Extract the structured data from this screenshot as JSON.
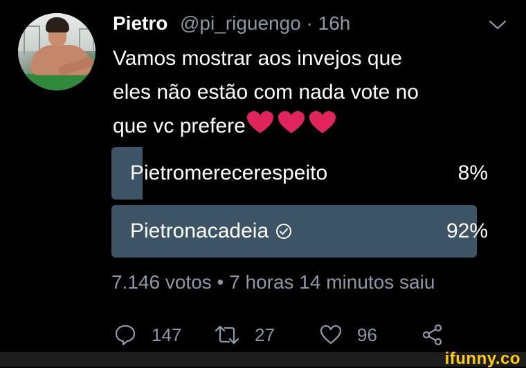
{
  "tweet": {
    "author_name": "Pietro",
    "handle_time": "@pi_riguengo · 16h",
    "text_lines": [
      "Vamos mostrar aos invejos que",
      "eles não estão com nada vote no",
      "que vc prefere"
    ],
    "emoji": "red-heart x3"
  },
  "poll": {
    "options": [
      {
        "label": "Pietromerecerespeito",
        "percent_text": "8%",
        "percent": 8,
        "selected": false
      },
      {
        "label": "Pietronacadeia",
        "percent_text": "92%",
        "percent": 92,
        "selected": true
      }
    ],
    "summary": "7.146 votos • 7 horas 14 minutos saiu"
  },
  "actions": {
    "reply_count": "147",
    "retweet_count": "27",
    "like_count": "96"
  },
  "watermark": "ifunny.co",
  "colors": {
    "background": "#000000",
    "poll_bar": "#3d5466",
    "secondary_text": "#8b98a5",
    "heart": "#e0245e",
    "watermark": "#ffcc00"
  }
}
